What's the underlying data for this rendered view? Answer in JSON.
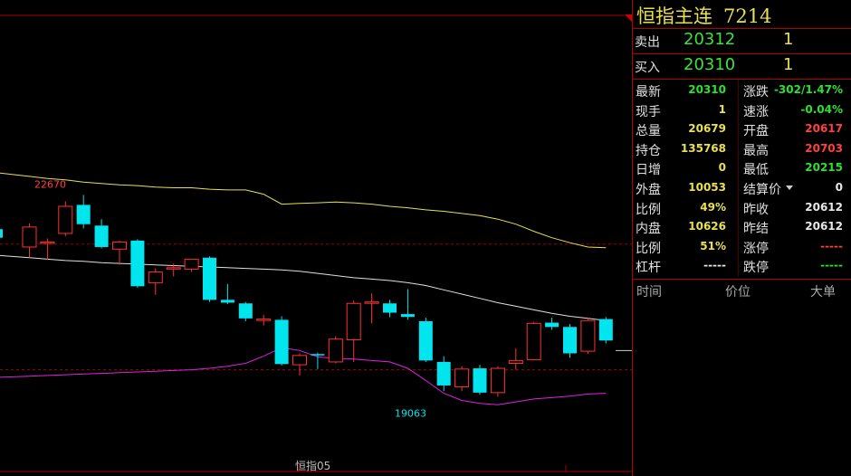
{
  "instrument": {
    "name": "恒指主连",
    "code": "7214"
  },
  "quotes": {
    "sell": {
      "label": "卖出",
      "price": "20312",
      "volume": "1"
    },
    "buy": {
      "label": "买入",
      "price": "20310",
      "volume": "1"
    }
  },
  "stats_left": [
    {
      "label": "最新",
      "value": "20310",
      "color": "green"
    },
    {
      "label": "现手",
      "value": "1",
      "color": "yellow"
    },
    {
      "label": "总量",
      "value": "20679",
      "color": "yellow"
    },
    {
      "label": "持仓",
      "value": "135768",
      "color": "yellow"
    },
    {
      "label": "日增",
      "value": "0",
      "color": "yellow"
    },
    {
      "label": "外盘",
      "value": "10053",
      "color": "yellow"
    },
    {
      "label": "比例",
      "value": "49%",
      "color": "yellow"
    },
    {
      "label": "内盘",
      "value": "10626",
      "color": "yellow"
    },
    {
      "label": "比例",
      "value": "51%",
      "color": "yellow"
    },
    {
      "label": "杠杆",
      "value": "-----",
      "color": "white"
    }
  ],
  "stats_right": [
    {
      "label": "涨跌",
      "value": "-302/1.47%",
      "color": "green"
    },
    {
      "label": "速涨",
      "value": "-0.04%",
      "color": "green"
    },
    {
      "label": "开盘",
      "value": "20617",
      "color": "red"
    },
    {
      "label": "最高",
      "value": "20703",
      "color": "red"
    },
    {
      "label": "最低",
      "value": "20215",
      "color": "green"
    },
    {
      "label": "结算价",
      "value": "0",
      "color": "white"
    },
    {
      "label": "昨收",
      "value": "20612",
      "color": "white"
    },
    {
      "label": "昨结",
      "value": "20612",
      "color": "white"
    },
    {
      "label": "涨停",
      "value": "-----",
      "color": "red"
    },
    {
      "label": "跌停",
      "value": "-----",
      "color": "green"
    }
  ],
  "tick_columns": [
    "时间",
    "价位",
    "大单"
  ],
  "chart": {
    "high_label": "22670",
    "low_label": "19063",
    "contract_label": "恒指05",
    "up_color": "#ff3030",
    "down_color": "#00e5ee",
    "upper_band_color": "#e8e050",
    "mid_band_color": "#e0e0e0",
    "lower_band_color": "#e020e0"
  },
  "chart_data": {
    "type": "candlestick",
    "candles": [
      {
        "o": 22050,
        "h": 22380,
        "l": 21900,
        "c": 22330
      },
      {
        "o": 22110,
        "h": 22170,
        "l": 21870,
        "c": 22120
      },
      {
        "o": 22240,
        "h": 22690,
        "l": 22200,
        "c": 22620
      },
      {
        "o": 22640,
        "h": 22780,
        "l": 22310,
        "c": 22370
      },
      {
        "o": 22350,
        "h": 22440,
        "l": 22030,
        "c": 22050
      },
      {
        "o": 22020,
        "h": 22140,
        "l": 21800,
        "c": 22120
      },
      {
        "o": 22140,
        "h": 22160,
        "l": 21480,
        "c": 21500
      },
      {
        "o": 21550,
        "h": 21750,
        "l": 21380,
        "c": 21700
      },
      {
        "o": 21760,
        "h": 21820,
        "l": 21640,
        "c": 21760
      },
      {
        "o": 21740,
        "h": 21860,
        "l": 21700,
        "c": 21880
      },
      {
        "o": 21900,
        "h": 21920,
        "l": 21280,
        "c": 21310
      },
      {
        "o": 21310,
        "h": 21530,
        "l": 21250,
        "c": 21270
      },
      {
        "o": 21260,
        "h": 21280,
        "l": 21010,
        "c": 21050
      },
      {
        "o": 21040,
        "h": 21100,
        "l": 20950,
        "c": 21040
      },
      {
        "o": 21030,
        "h": 21080,
        "l": 20390,
        "c": 20410
      },
      {
        "o": 20400,
        "h": 20560,
        "l": 20250,
        "c": 20530
      },
      {
        "o": 20550,
        "h": 20570,
        "l": 20340,
        "c": 20540
      },
      {
        "o": 20440,
        "h": 20800,
        "l": 20420,
        "c": 20760
      },
      {
        "o": 20750,
        "h": 21300,
        "l": 20440,
        "c": 21260
      },
      {
        "o": 21280,
        "h": 21400,
        "l": 20980,
        "c": 21280
      },
      {
        "o": 21260,
        "h": 21310,
        "l": 21070,
        "c": 21130
      },
      {
        "o": 21110,
        "h": 21460,
        "l": 21030,
        "c": 21070
      },
      {
        "o": 21010,
        "h": 21060,
        "l": 20440,
        "c": 20460
      },
      {
        "o": 20440,
        "h": 20520,
        "l": 20030,
        "c": 20110
      },
      {
        "o": 20090,
        "h": 20380,
        "l": 20030,
        "c": 20340
      },
      {
        "o": 20350,
        "h": 20400,
        "l": 19980,
        "c": 20010
      },
      {
        "o": 20010,
        "h": 20380,
        "l": 19950,
        "c": 20350
      },
      {
        "o": 20420,
        "h": 20630,
        "l": 20330,
        "c": 20460
      },
      {
        "o": 20470,
        "h": 21000,
        "l": 20460,
        "c": 20980
      },
      {
        "o": 20990,
        "h": 21060,
        "l": 20890,
        "c": 20930
      },
      {
        "o": 20930,
        "h": 20970,
        "l": 20500,
        "c": 20560
      },
      {
        "o": 20590,
        "h": 21060,
        "l": 20550,
        "c": 21020
      },
      {
        "o": 21040,
        "h": 21070,
        "l": 20700,
        "c": 20740
      }
    ],
    "upper_band": [
      23040,
      23010,
      22990,
      22960,
      22940,
      22920,
      22910,
      22890,
      22880,
      22880,
      22860,
      22850,
      22850,
      22790,
      22650,
      22660,
      22670,
      22680,
      22670,
      22650,
      22620,
      22600,
      22570,
      22550,
      22520,
      22490,
      22440,
      22370,
      22270,
      22180,
      22110,
      22050,
      22040
    ],
    "middle_band": [
      21900,
      21880,
      21860,
      21850,
      21830,
      21820,
      21810,
      21800,
      21790,
      21780,
      21770,
      21760,
      21750,
      21740,
      21730,
      21710,
      21680,
      21650,
      21620,
      21600,
      21580,
      21550,
      21510,
      21450,
      21390,
      21330,
      21270,
      21220,
      21170,
      21120,
      21080,
      21050,
      21020
    ],
    "lower_band": [
      20240,
      20250,
      20260,
      20270,
      20280,
      20290,
      20300,
      20310,
      20320,
      20330,
      20350,
      20380,
      20420,
      20520,
      20640,
      20600,
      20510,
      20490,
      20480,
      20460,
      20440,
      20350,
      20180,
      20000,
      19900,
      19860,
      19840,
      19880,
      19920,
      19940,
      19960,
      19990,
      20000
    ]
  }
}
